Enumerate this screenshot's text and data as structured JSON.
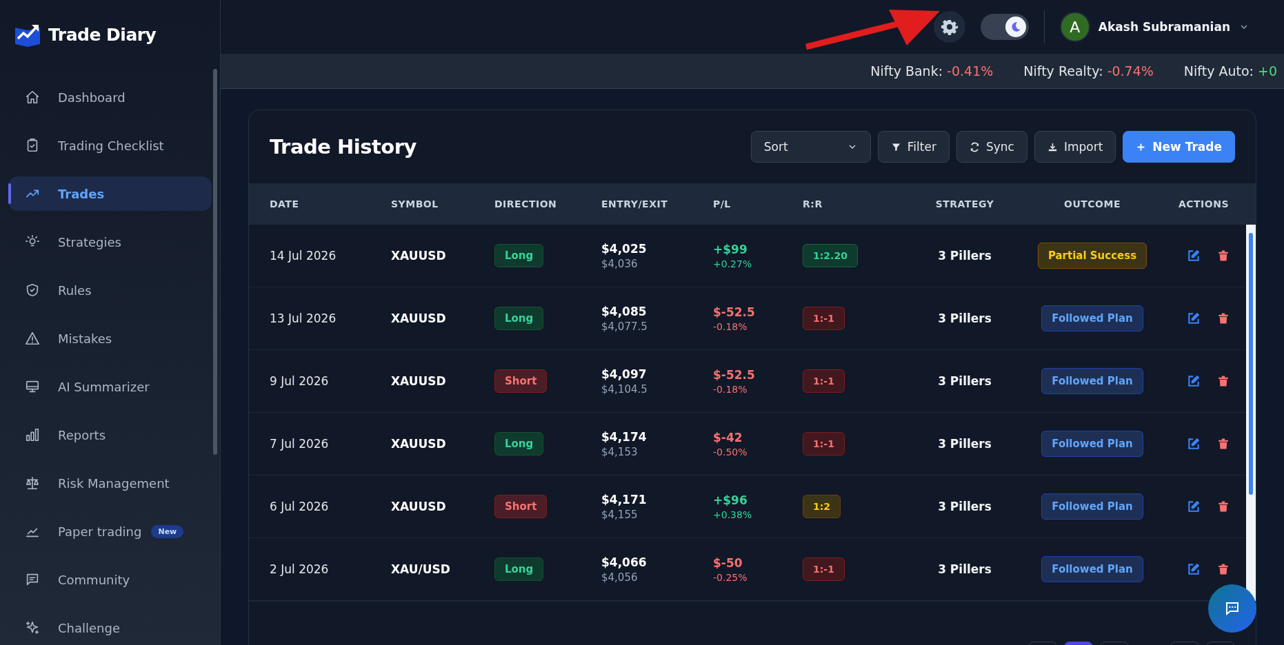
{
  "sidebar": {
    "logo": "Trade Diary",
    "items": [
      {
        "label": "Dashboard",
        "selected": false
      },
      {
        "label": "Trading Checklist",
        "selected": false
      },
      {
        "label": "Trades",
        "selected": true
      },
      {
        "label": "Strategies",
        "selected": false
      },
      {
        "label": "Rules",
        "selected": false
      },
      {
        "label": "Mistakes",
        "selected": false
      },
      {
        "label": "AI Summarizer",
        "selected": false
      },
      {
        "label": "Reports",
        "selected": false
      },
      {
        "label": "Risk Management",
        "selected": false
      },
      {
        "label": "Paper trading",
        "selected": false,
        "badge": "New"
      },
      {
        "label": "Community",
        "selected": false
      },
      {
        "label": "Challenge",
        "selected": false
      }
    ]
  },
  "header": {
    "dark_mode": {
      "on": true
    },
    "user": {
      "initial": "A",
      "name": "Akash Subramanian"
    }
  },
  "ticker": [
    {
      "label": "Nifty Bank:",
      "value": "-0.41%",
      "kind": "down"
    },
    {
      "label": "Nifty Realty:",
      "value": "-0.74%",
      "kind": "down"
    },
    {
      "label": "Nifty Auto:",
      "value": "+0",
      "kind": "up"
    }
  ],
  "trade_history": {
    "title": "Trade History",
    "sort": {
      "value": "Sort"
    },
    "buttons": [
      {
        "label": "Filter",
        "kind": "filter"
      },
      {
        "label": "Sync",
        "kind": "sync"
      },
      {
        "label": "Import",
        "kind": "import"
      },
      {
        "label": "New Trade",
        "kind": "new"
      }
    ],
    "columns": [
      "DATE",
      "SYMBOL",
      "DIRECTION",
      "ENTRY/EXIT",
      "P/L",
      "R:R",
      "STRATEGY",
      "OUTCOME",
      "ACTIONS"
    ],
    "rows": [
      {
        "date": "14 Jul 2026",
        "symbol": "XAUUSD",
        "direction": {
          "label": "Long",
          "kind": "long"
        },
        "entry": "$4,025",
        "exit": "$4,036",
        "pl": {
          "amount": "+$99",
          "percent": "+0.27%",
          "kind": "gain"
        },
        "rr": {
          "label": "1:2.20",
          "kind": "win"
        },
        "strategy": "3 Pillers",
        "outcome": {
          "label": "Partial Success",
          "kind": "partial"
        }
      },
      {
        "date": "13 Jul 2026",
        "symbol": "XAUUSD",
        "direction": {
          "label": "Long",
          "kind": "long"
        },
        "entry": "$4,085",
        "exit": "$4,077.5",
        "pl": {
          "amount": "$-52.5",
          "percent": "-0.18%",
          "kind": "loss"
        },
        "rr": {
          "label": "1:-1",
          "kind": "loss"
        },
        "strategy": "3 Pillers",
        "outcome": {
          "label": "Followed Plan",
          "kind": "followed"
        }
      },
      {
        "date": "9 Jul 2026",
        "symbol": "XAUUSD",
        "direction": {
          "label": "Short",
          "kind": "short"
        },
        "entry": "$4,097",
        "exit": "$4,104.5",
        "pl": {
          "amount": "$-52.5",
          "percent": "-0.18%",
          "kind": "loss"
        },
        "rr": {
          "label": "1:-1",
          "kind": "loss"
        },
        "strategy": "3 Pillers",
        "outcome": {
          "label": "Followed Plan",
          "kind": "followed"
        }
      },
      {
        "date": "7 Jul 2026",
        "symbol": "XAUUSD",
        "direction": {
          "label": "Long",
          "kind": "long"
        },
        "entry": "$4,174",
        "exit": "$4,153",
        "pl": {
          "amount": "$-42",
          "percent": "-0.50%",
          "kind": "loss"
        },
        "rr": {
          "label": "1:-1",
          "kind": "loss"
        },
        "strategy": "3 Pillers",
        "outcome": {
          "label": "Followed Plan",
          "kind": "followed"
        }
      },
      {
        "date": "6 Jul 2026",
        "symbol": "XAUUSD",
        "direction": {
          "label": "Short",
          "kind": "short"
        },
        "entry": "$4,171",
        "exit": "$4,155",
        "pl": {
          "amount": "+$96",
          "percent": "+0.38%",
          "kind": "gain"
        },
        "rr": {
          "label": "1:2",
          "kind": "even"
        },
        "strategy": "3 Pillers",
        "outcome": {
          "label": "Followed Plan",
          "kind": "followed"
        }
      },
      {
        "date": "2 Jul 2026",
        "symbol": "XAU/USD",
        "direction": {
          "label": "Long",
          "kind": "long"
        },
        "entry": "$4,066",
        "exit": "$4,056",
        "pl": {
          "amount": "$-50",
          "percent": "-0.25%",
          "kind": "loss"
        },
        "rr": {
          "label": "1:-1",
          "kind": "loss"
        },
        "strategy": "3 Pillers",
        "outcome": {
          "label": "Followed Plan",
          "kind": "followed"
        }
      }
    ],
    "pagination": [
      {
        "selected": true
      },
      {
        "selected": false
      }
    ]
  }
}
